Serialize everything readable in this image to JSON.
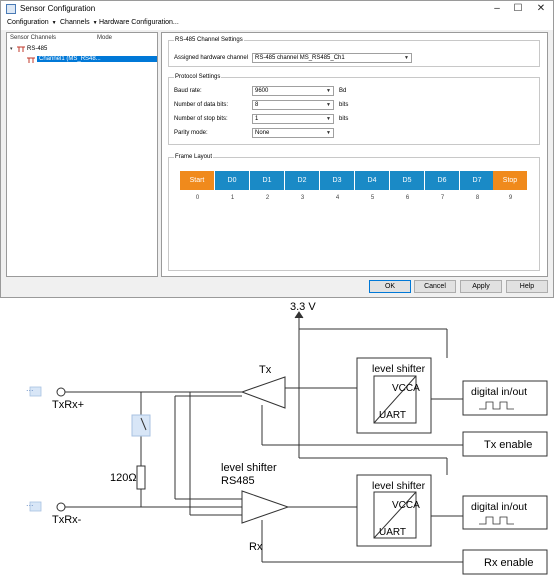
{
  "window": {
    "title": "Sensor Configuration",
    "controls": [
      "–",
      "☐",
      "✕"
    ]
  },
  "menu": [
    {
      "label": "Configuration"
    },
    {
      "label": "Channels"
    },
    {
      "label": "Hardware Configuration..."
    }
  ],
  "tree": {
    "col_channels": "Sensor Channels",
    "col_mode": "Mode",
    "root": "RS-485",
    "child": "Channel1 (MS_RS48..."
  },
  "channel_settings": {
    "title": "RS-485 Channel Settings",
    "hw_label": "Assigned hardware channel",
    "hw_value": "RS-485 channel  MS_RS485_Ch1"
  },
  "protocol": {
    "title": "Protocol Settings",
    "baud_label": "Baud rate:",
    "baud_value": "9600",
    "baud_unit": "Bd",
    "data_bits_label": "Number of data bits:",
    "data_bits_value": "8",
    "data_bits_unit": "bits",
    "stop_bits_label": "Number of stop bits:",
    "stop_bits_value": "1",
    "stop_bits_unit": "bits",
    "parity_label": "Parity mode:",
    "parity_value": "None"
  },
  "frame": {
    "title": "Frame Layout",
    "cells": [
      "Start",
      "D0",
      "D1",
      "D2",
      "D3",
      "D4",
      "D5",
      "D6",
      "D7",
      "Stop"
    ],
    "indices": [
      "0",
      "1",
      "2",
      "3",
      "4",
      "5",
      "6",
      "7",
      "8",
      "9"
    ],
    "colors": {
      "edge": "#f08a1c",
      "data": "#1a8ac6"
    }
  },
  "buttons": {
    "ok": "OK",
    "cancel": "Cancel",
    "apply": "Apply",
    "help": "Help"
  },
  "diagram": {
    "supply": "3.3 V",
    "txrx_plus": "TxRx+",
    "txrx_minus": "TxRx-",
    "resistor": "120Ω",
    "tx": "Tx",
    "rx": "Rx",
    "ls_rs485_line1": "level shifter",
    "ls_rs485_line2": "RS485",
    "ls_top_title": "level shifter",
    "ls_bottom_title": "level shifter",
    "vcca": "VCCA",
    "uart": "UART",
    "dio_top": "digital in/out",
    "dio_bottom": "digital in/out",
    "tx_enable": "Tx enable",
    "rx_enable": "Rx enable",
    "ellipsis": "..."
  }
}
